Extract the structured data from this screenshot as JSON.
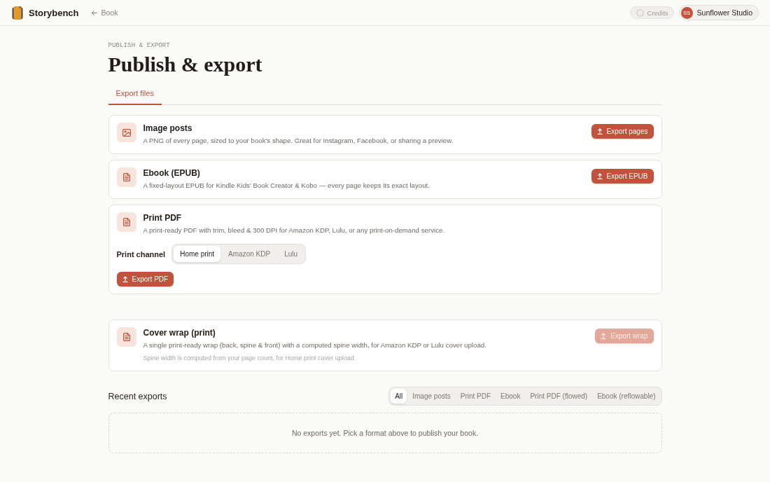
{
  "header": {
    "brand": "Storybench",
    "back_link": "Book",
    "credits": "Credits",
    "account": {
      "initials": "SS",
      "name": "Sunflower Studio"
    }
  },
  "page": {
    "eyebrow": "PUBLISH & EXPORT",
    "title": "Publish & export"
  },
  "tabs": [
    {
      "label": "Export files",
      "selected": true
    }
  ],
  "export_cards": [
    {
      "kind": "image",
      "title": "Image posts",
      "description": "A PNG of every page, sized to your book's shape. Great for Instagram, Facebook, or sharing a preview.",
      "button": {
        "label": "Export pages",
        "disabled": false
      }
    },
    {
      "kind": "document",
      "title": "Ebook (EPUB)",
      "description": "A fixed-layout EPUB for Kindle Kids' Book Creator & Kobo — every page keeps its exact layout.",
      "button": {
        "label": "Export EPUB",
        "disabled": false
      }
    },
    {
      "kind": "document",
      "title": "Print PDF",
      "description": "A print-ready PDF with trim, bleed & 300 DPI for Amazon KDP, Lulu, or any print-on-demand service.",
      "print_channel": {
        "label": "Print channel",
        "options": [
          {
            "label": "Home print",
            "selected": true
          },
          {
            "label": "Amazon KDP",
            "selected": false
          },
          {
            "label": "Lulu",
            "selected": false
          }
        ]
      },
      "button": {
        "label": "Export PDF",
        "disabled": false
      }
    }
  ],
  "cover_cards": [
    {
      "kind": "document",
      "title": "Cover wrap (print)",
      "description": "A single print-ready wrap (back, spine & front) with a computed spine width, for Amazon KDP or Lulu cover upload.",
      "note": "Spine width is computed from your page count, for Home print cover upload.",
      "button": {
        "label": "Export wrap",
        "disabled": true
      }
    }
  ],
  "recent_exports": {
    "title": "Recent exports",
    "filters": [
      {
        "label": "All",
        "selected": true
      },
      {
        "label": "Image posts",
        "selected": false
      },
      {
        "label": "Print PDF",
        "selected": false
      },
      {
        "label": "Ebook",
        "selected": false
      },
      {
        "label": "Print PDF (flowed)",
        "selected": false
      },
      {
        "label": "Ebook (reflowable)",
        "selected": false
      }
    ],
    "empty_message": "No exports yet. Pick a format above to publish your book."
  }
}
